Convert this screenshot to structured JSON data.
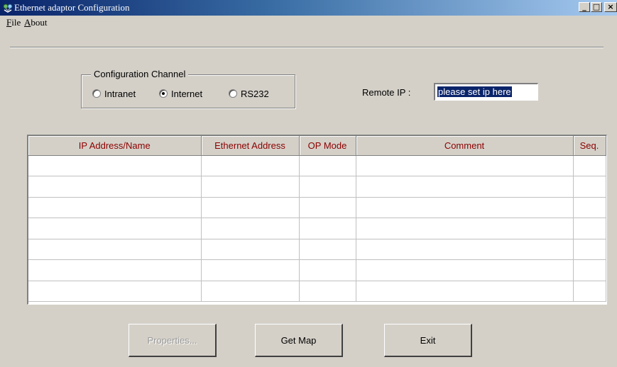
{
  "window": {
    "title": "Ethernet adaptor Configuration",
    "icon": "network-adapter-icon",
    "minimize_label": "_",
    "maximize_label": "□",
    "close_label": "×"
  },
  "menu": {
    "items": [
      {
        "mnemonic": "F",
        "rest": "ile"
      },
      {
        "mnemonic": "A",
        "rest": "bout"
      }
    ]
  },
  "config_channel": {
    "label": "Configuration Channel",
    "options": [
      {
        "label": "Intranet",
        "checked": false
      },
      {
        "label": "Internet",
        "checked": true
      },
      {
        "label": "RS232",
        "checked": false
      }
    ]
  },
  "remote_ip": {
    "label": "Remote IP :",
    "value": "please set ip here"
  },
  "table": {
    "columns": [
      "IP Address/Name",
      "Ethernet Address",
      "OP Mode",
      "Comment",
      "Seq."
    ],
    "header_color": "#8b0000",
    "rows": [
      [
        "",
        "",
        "",
        "",
        ""
      ],
      [
        "",
        "",
        "",
        "",
        ""
      ],
      [
        "",
        "",
        "",
        "",
        ""
      ],
      [
        "",
        "",
        "",
        "",
        ""
      ],
      [
        "",
        "",
        "",
        "",
        ""
      ],
      [
        "",
        "",
        "",
        "",
        ""
      ],
      [
        "",
        "",
        "",
        "",
        ""
      ]
    ]
  },
  "buttons": {
    "properties": "Properties...",
    "get_map": "Get Map",
    "exit": "Exit"
  }
}
